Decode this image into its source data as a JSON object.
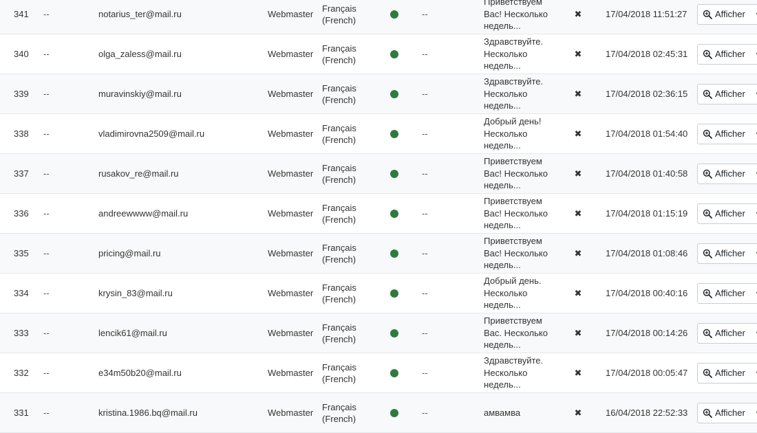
{
  "colors": {
    "status_dot": "#2f7a3e",
    "row_alt_bg": "#f8f9fa",
    "border": "#e4e7ea"
  },
  "icons": {
    "status": "status-dot-icon",
    "delete": "close-icon",
    "view": "zoom-in-icon",
    "dropdown": "caret-down-icon"
  },
  "rows": [
    {
      "id": "341",
      "dash1": "--",
      "email": "notarius_ter@mail.ru",
      "role": "Webmaster",
      "lang1": "Français",
      "lang2": "(French)",
      "dash2": "--",
      "msg": [
        "Приветствуем",
        "Вас! Несколько",
        "недель..."
      ],
      "x": "✖",
      "date": "17/04/2018 11:51:27",
      "action": "Afficher"
    },
    {
      "id": "340",
      "dash1": "--",
      "email": "olga_zaless@mail.ru",
      "role": "Webmaster",
      "lang1": "Français",
      "lang2": "(French)",
      "dash2": "--",
      "msg": [
        "Здравствуйте.",
        "Несколько",
        "недель..."
      ],
      "x": "✖",
      "date": "17/04/2018 02:45:31",
      "action": "Afficher"
    },
    {
      "id": "339",
      "dash1": "--",
      "email": "muravinskiy@mail.ru",
      "role": "Webmaster",
      "lang1": "Français",
      "lang2": "(French)",
      "dash2": "--",
      "msg": [
        "Здравствуйте.",
        "Несколько",
        "недель..."
      ],
      "x": "✖",
      "date": "17/04/2018 02:36:15",
      "action": "Afficher"
    },
    {
      "id": "338",
      "dash1": "--",
      "email": "vladimirovna2509@mail.ru",
      "role": "Webmaster",
      "lang1": "Français",
      "lang2": "(French)",
      "dash2": "--",
      "msg": [
        "Добрый день!",
        "Несколько",
        "недель..."
      ],
      "x": "✖",
      "date": "17/04/2018 01:54:40",
      "action": "Afficher"
    },
    {
      "id": "337",
      "dash1": "--",
      "email": "rusakov_re@mail.ru",
      "role": "Webmaster",
      "lang1": "Français",
      "lang2": "(French)",
      "dash2": "--",
      "msg": [
        "Приветствуем",
        "Вас! Несколько",
        "недель..."
      ],
      "x": "✖",
      "date": "17/04/2018 01:40:58",
      "action": "Afficher"
    },
    {
      "id": "336",
      "dash1": "--",
      "email": "andreewwww@mail.ru",
      "role": "Webmaster",
      "lang1": "Français",
      "lang2": "(French)",
      "dash2": "--",
      "msg": [
        "Приветствуем",
        "Вас! Несколько",
        "недель..."
      ],
      "x": "✖",
      "date": "17/04/2018 01:15:19",
      "action": "Afficher"
    },
    {
      "id": "335",
      "dash1": "--",
      "email": "pricing@mail.ru",
      "role": "Webmaster",
      "lang1": "Français",
      "lang2": "(French)",
      "dash2": "--",
      "msg": [
        "Приветствуем",
        "Вас! Несколько",
        "недель..."
      ],
      "x": "✖",
      "date": "17/04/2018 01:08:46",
      "action": "Afficher"
    },
    {
      "id": "334",
      "dash1": "--",
      "email": "krysin_83@mail.ru",
      "role": "Webmaster",
      "lang1": "Français",
      "lang2": "(French)",
      "dash2": "--",
      "msg": [
        "Добрый день.",
        "Несколько",
        "недель..."
      ],
      "x": "✖",
      "date": "17/04/2018 00:40:16",
      "action": "Afficher"
    },
    {
      "id": "333",
      "dash1": "--",
      "email": "lencik61@mail.ru",
      "role": "Webmaster",
      "lang1": "Français",
      "lang2": "(French)",
      "dash2": "--",
      "msg": [
        "Приветствуем",
        "Вас. Несколько",
        "недель..."
      ],
      "x": "✖",
      "date": "17/04/2018 00:14:26",
      "action": "Afficher"
    },
    {
      "id": "332",
      "dash1": "--",
      "email": "e34m50b20@mail.ru",
      "role": "Webmaster",
      "lang1": "Français",
      "lang2": "(French)",
      "dash2": "--",
      "msg": [
        "Здравствуйте.",
        "Несколько",
        "недель..."
      ],
      "x": "✖",
      "date": "17/04/2018 00:05:47",
      "action": "Afficher"
    },
    {
      "id": "331",
      "dash1": "--",
      "email": "kristina.1986.bq@mail.ru",
      "role": "Webmaster",
      "lang1": "Français",
      "lang2": "(French)",
      "dash2": "--",
      "msg": [
        "амвамва"
      ],
      "x": "✖",
      "date": "16/04/2018 22:52:33",
      "action": "Afficher"
    }
  ]
}
